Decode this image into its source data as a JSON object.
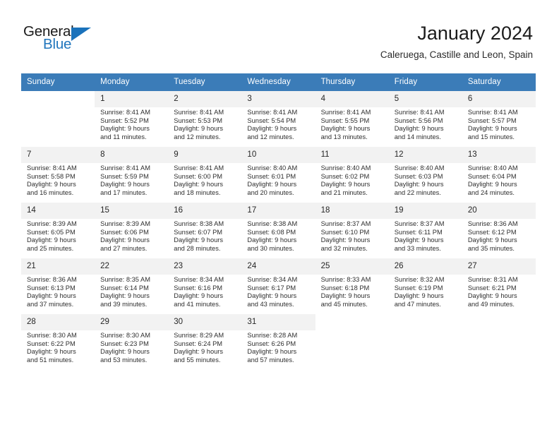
{
  "brand": {
    "name_top": "General",
    "name_bottom": "Blue",
    "accent_color": "#1a72bb",
    "header_color": "#3b7cb8"
  },
  "header": {
    "title": "January 2024",
    "subtitle": "Caleruega, Castille and Leon, Spain"
  },
  "calendar": {
    "weekday_headers": [
      "Sunday",
      "Monday",
      "Tuesday",
      "Wednesday",
      "Thursday",
      "Friday",
      "Saturday"
    ],
    "weeks": [
      [
        {
          "day": "",
          "sunrise": "",
          "sunset": "",
          "daylight_1": "",
          "daylight_2": "",
          "empty": true
        },
        {
          "day": "1",
          "sunrise": "Sunrise: 8:41 AM",
          "sunset": "Sunset: 5:52 PM",
          "daylight_1": "Daylight: 9 hours",
          "daylight_2": "and 11 minutes."
        },
        {
          "day": "2",
          "sunrise": "Sunrise: 8:41 AM",
          "sunset": "Sunset: 5:53 PM",
          "daylight_1": "Daylight: 9 hours",
          "daylight_2": "and 12 minutes."
        },
        {
          "day": "3",
          "sunrise": "Sunrise: 8:41 AM",
          "sunset": "Sunset: 5:54 PM",
          "daylight_1": "Daylight: 9 hours",
          "daylight_2": "and 12 minutes."
        },
        {
          "day": "4",
          "sunrise": "Sunrise: 8:41 AM",
          "sunset": "Sunset: 5:55 PM",
          "daylight_1": "Daylight: 9 hours",
          "daylight_2": "and 13 minutes."
        },
        {
          "day": "5",
          "sunrise": "Sunrise: 8:41 AM",
          "sunset": "Sunset: 5:56 PM",
          "daylight_1": "Daylight: 9 hours",
          "daylight_2": "and 14 minutes."
        },
        {
          "day": "6",
          "sunrise": "Sunrise: 8:41 AM",
          "sunset": "Sunset: 5:57 PM",
          "daylight_1": "Daylight: 9 hours",
          "daylight_2": "and 15 minutes."
        }
      ],
      [
        {
          "day": "7",
          "sunrise": "Sunrise: 8:41 AM",
          "sunset": "Sunset: 5:58 PM",
          "daylight_1": "Daylight: 9 hours",
          "daylight_2": "and 16 minutes."
        },
        {
          "day": "8",
          "sunrise": "Sunrise: 8:41 AM",
          "sunset": "Sunset: 5:59 PM",
          "daylight_1": "Daylight: 9 hours",
          "daylight_2": "and 17 minutes."
        },
        {
          "day": "9",
          "sunrise": "Sunrise: 8:41 AM",
          "sunset": "Sunset: 6:00 PM",
          "daylight_1": "Daylight: 9 hours",
          "daylight_2": "and 18 minutes."
        },
        {
          "day": "10",
          "sunrise": "Sunrise: 8:40 AM",
          "sunset": "Sunset: 6:01 PM",
          "daylight_1": "Daylight: 9 hours",
          "daylight_2": "and 20 minutes."
        },
        {
          "day": "11",
          "sunrise": "Sunrise: 8:40 AM",
          "sunset": "Sunset: 6:02 PM",
          "daylight_1": "Daylight: 9 hours",
          "daylight_2": "and 21 minutes."
        },
        {
          "day": "12",
          "sunrise": "Sunrise: 8:40 AM",
          "sunset": "Sunset: 6:03 PM",
          "daylight_1": "Daylight: 9 hours",
          "daylight_2": "and 22 minutes."
        },
        {
          "day": "13",
          "sunrise": "Sunrise: 8:40 AM",
          "sunset": "Sunset: 6:04 PM",
          "daylight_1": "Daylight: 9 hours",
          "daylight_2": "and 24 minutes."
        }
      ],
      [
        {
          "day": "14",
          "sunrise": "Sunrise: 8:39 AM",
          "sunset": "Sunset: 6:05 PM",
          "daylight_1": "Daylight: 9 hours",
          "daylight_2": "and 25 minutes."
        },
        {
          "day": "15",
          "sunrise": "Sunrise: 8:39 AM",
          "sunset": "Sunset: 6:06 PM",
          "daylight_1": "Daylight: 9 hours",
          "daylight_2": "and 27 minutes."
        },
        {
          "day": "16",
          "sunrise": "Sunrise: 8:38 AM",
          "sunset": "Sunset: 6:07 PM",
          "daylight_1": "Daylight: 9 hours",
          "daylight_2": "and 28 minutes."
        },
        {
          "day": "17",
          "sunrise": "Sunrise: 8:38 AM",
          "sunset": "Sunset: 6:08 PM",
          "daylight_1": "Daylight: 9 hours",
          "daylight_2": "and 30 minutes."
        },
        {
          "day": "18",
          "sunrise": "Sunrise: 8:37 AM",
          "sunset": "Sunset: 6:10 PM",
          "daylight_1": "Daylight: 9 hours",
          "daylight_2": "and 32 minutes."
        },
        {
          "day": "19",
          "sunrise": "Sunrise: 8:37 AM",
          "sunset": "Sunset: 6:11 PM",
          "daylight_1": "Daylight: 9 hours",
          "daylight_2": "and 33 minutes."
        },
        {
          "day": "20",
          "sunrise": "Sunrise: 8:36 AM",
          "sunset": "Sunset: 6:12 PM",
          "daylight_1": "Daylight: 9 hours",
          "daylight_2": "and 35 minutes."
        }
      ],
      [
        {
          "day": "21",
          "sunrise": "Sunrise: 8:36 AM",
          "sunset": "Sunset: 6:13 PM",
          "daylight_1": "Daylight: 9 hours",
          "daylight_2": "and 37 minutes."
        },
        {
          "day": "22",
          "sunrise": "Sunrise: 8:35 AM",
          "sunset": "Sunset: 6:14 PM",
          "daylight_1": "Daylight: 9 hours",
          "daylight_2": "and 39 minutes."
        },
        {
          "day": "23",
          "sunrise": "Sunrise: 8:34 AM",
          "sunset": "Sunset: 6:16 PM",
          "daylight_1": "Daylight: 9 hours",
          "daylight_2": "and 41 minutes."
        },
        {
          "day": "24",
          "sunrise": "Sunrise: 8:34 AM",
          "sunset": "Sunset: 6:17 PM",
          "daylight_1": "Daylight: 9 hours",
          "daylight_2": "and 43 minutes."
        },
        {
          "day": "25",
          "sunrise": "Sunrise: 8:33 AM",
          "sunset": "Sunset: 6:18 PM",
          "daylight_1": "Daylight: 9 hours",
          "daylight_2": "and 45 minutes."
        },
        {
          "day": "26",
          "sunrise": "Sunrise: 8:32 AM",
          "sunset": "Sunset: 6:19 PM",
          "daylight_1": "Daylight: 9 hours",
          "daylight_2": "and 47 minutes."
        },
        {
          "day": "27",
          "sunrise": "Sunrise: 8:31 AM",
          "sunset": "Sunset: 6:21 PM",
          "daylight_1": "Daylight: 9 hours",
          "daylight_2": "and 49 minutes."
        }
      ],
      [
        {
          "day": "28",
          "sunrise": "Sunrise: 8:30 AM",
          "sunset": "Sunset: 6:22 PM",
          "daylight_1": "Daylight: 9 hours",
          "daylight_2": "and 51 minutes."
        },
        {
          "day": "29",
          "sunrise": "Sunrise: 8:30 AM",
          "sunset": "Sunset: 6:23 PM",
          "daylight_1": "Daylight: 9 hours",
          "daylight_2": "and 53 minutes."
        },
        {
          "day": "30",
          "sunrise": "Sunrise: 8:29 AM",
          "sunset": "Sunset: 6:24 PM",
          "daylight_1": "Daylight: 9 hours",
          "daylight_2": "and 55 minutes."
        },
        {
          "day": "31",
          "sunrise": "Sunrise: 8:28 AM",
          "sunset": "Sunset: 6:26 PM",
          "daylight_1": "Daylight: 9 hours",
          "daylight_2": "and 57 minutes."
        },
        {
          "day": "",
          "sunrise": "",
          "sunset": "",
          "daylight_1": "",
          "daylight_2": "",
          "empty": true
        },
        {
          "day": "",
          "sunrise": "",
          "sunset": "",
          "daylight_1": "",
          "daylight_2": "",
          "empty": true
        },
        {
          "day": "",
          "sunrise": "",
          "sunset": "",
          "daylight_1": "",
          "daylight_2": "",
          "empty": true
        }
      ]
    ]
  }
}
